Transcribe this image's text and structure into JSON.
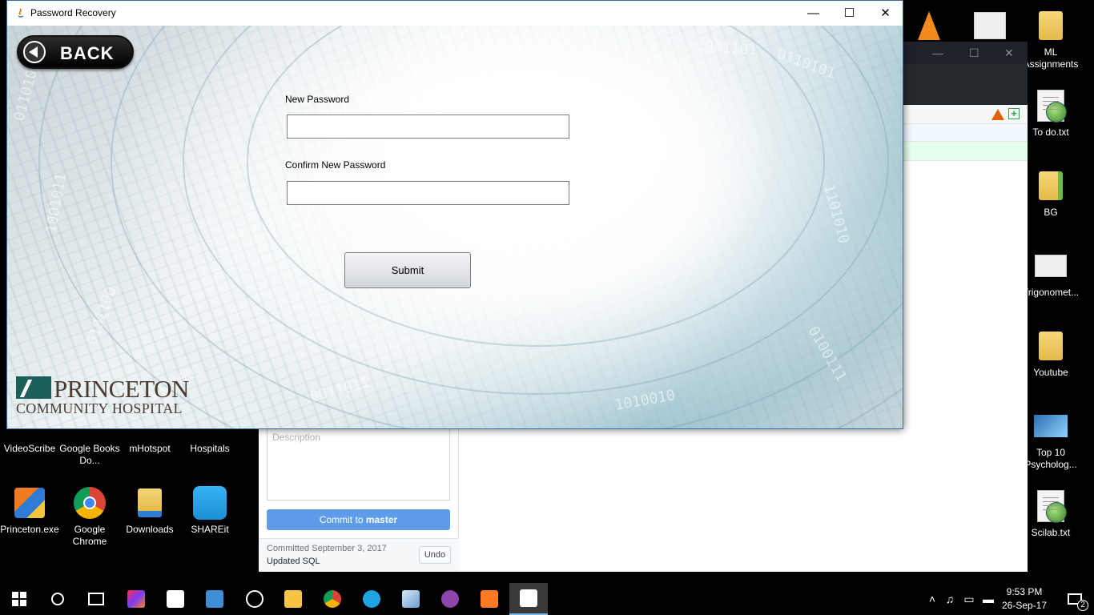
{
  "window": {
    "title": "Password Recovery",
    "minimize": "—",
    "maximize": "☐",
    "close": "✕"
  },
  "form": {
    "back_label": "BACK",
    "new_password_label": "New Password",
    "new_password_value": "",
    "confirm_password_label": "Confirm New Password",
    "confirm_password_value": "",
    "submit_label": "Submit"
  },
  "logo": {
    "line1": "PRINCETON",
    "line2": "COMMUNITY HOSPITAL"
  },
  "background_git": {
    "description_placeholder": "Description",
    "commit_prefix": "Commit to ",
    "commit_branch": "master",
    "committed_text": "Committed September 3, 2017",
    "commit_message": "Updated SQL",
    "undo_label": "Undo"
  },
  "desktop_icons": {
    "ml_assignments": "ML Assignments",
    "todo": "To do.txt",
    "bg": "BG",
    "trig": "Trigonomet...",
    "youtube": "Youtube",
    "top10": "Top 10 Psycholog...",
    "scilab": "Scilab.txt",
    "videoscribe": "VideoScribe",
    "google_books": "Google Books Do...",
    "mhotspot": "mHotspot",
    "hospitals": "Hospitals",
    "princeton_exe": "Princeton.exe",
    "google_chrome": "Google Chrome",
    "downloads": "Downloads",
    "shareit": "SHAREit"
  },
  "taskbar": {
    "time": "9:53 PM",
    "date": "26-Sep-17",
    "notifications": "2"
  },
  "colors": {
    "window_border": "#3a6ea5",
    "commit_button": "#5e9be8",
    "logo_text": "#4a3c33",
    "logo_mark": "#1d5f5a"
  }
}
